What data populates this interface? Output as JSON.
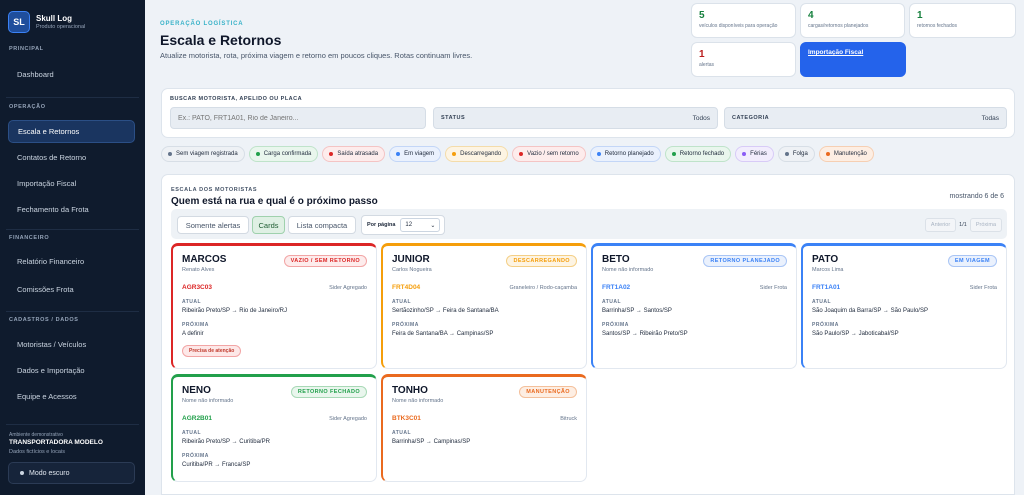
{
  "colors": {
    "sidebar_bg": "#0f1b2d",
    "primary": "#2463eb",
    "red": "#dc2626",
    "orange": "#f59e0b",
    "blue": "#3b82f6",
    "green": "#22a04b",
    "deep_orange": "#ea6a1f"
  },
  "sidebar": {
    "brand_logo": "SL",
    "brand_name": "Skull Log",
    "brand_sub": "Produto operacional",
    "sections": [
      {
        "title": "PRINCIPAL",
        "items": [
          {
            "label": "Dashboard"
          }
        ]
      },
      {
        "title": "OPERAÇÃO",
        "items": [
          {
            "label": "Escala e Retornos"
          },
          {
            "label": "Contatos de Retorno"
          },
          {
            "label": "Importação Fiscal"
          },
          {
            "label": "Fechamento da Frota"
          }
        ]
      },
      {
        "title": "FINANCEIRO",
        "items": [
          {
            "label": "Relatório Financeiro"
          },
          {
            "label": "Comissões Frota"
          }
        ]
      },
      {
        "title": "CADASTROS / DADOS",
        "items": [
          {
            "label": "Motoristas / Veículos"
          },
          {
            "label": "Dados e Importação"
          },
          {
            "label": "Equipe e Acessos"
          }
        ]
      }
    ],
    "demo_label": "Ambiente demonstrativo",
    "company": "TRANSPORTADORA MODELO",
    "demo_data": "Dados fictícios e locais",
    "dark_mode_label": "Modo escuro"
  },
  "header": {
    "eyebrow": "OPERAÇÃO LOGÍSTICA",
    "title": "Escala e Retornos",
    "subtitle": "Atualize motorista, rota, próxima viagem e retorno em poucos cliques. Rotas continuam livres."
  },
  "stats": [
    {
      "value": "5",
      "label": "veículos disponíveis para operação",
      "color": "#15803d"
    },
    {
      "value": "4",
      "label": "cargas/retornos planejados",
      "color": "#15803d"
    },
    {
      "value": "1",
      "label": "retornos fechados",
      "color": "#15803d"
    },
    {
      "value": "1",
      "label": "alertas",
      "color": "#b91c1c"
    }
  ],
  "import_button": "Importação Fiscal",
  "filters": {
    "search_label": "BUSCAR MOTORISTA, APELIDO OU PLACA",
    "search_placeholder": "Ex.: PATO, FRT1A01, Rio de Janeiro...",
    "status_label": "STATUS",
    "status_value": "Todos",
    "category_label": "CATEGORIA",
    "category_value": "Todas"
  },
  "legend": [
    {
      "label": "Sem viagem registrada",
      "dot": "#64748b",
      "bg": "#eef1f5",
      "border": "#d7dee6"
    },
    {
      "label": "Carga confirmada",
      "dot": "#22a04b",
      "bg": "#e9f6ed",
      "border": "#bfe3ca"
    },
    {
      "label": "Saída atrasada",
      "dot": "#dc2626",
      "bg": "#fdecec",
      "border": "#f4c4c4"
    },
    {
      "label": "Em viagem",
      "dot": "#3b82f6",
      "bg": "#eaf1fd",
      "border": "#c3d6f7"
    },
    {
      "label": "Descarregando",
      "dot": "#f59e0b",
      "bg": "#fdf4e3",
      "border": "#f4dcaa"
    },
    {
      "label": "Vazio / sem retorno",
      "dot": "#dc2626",
      "bg": "#fdecec",
      "border": "#f4c4c4"
    },
    {
      "label": "Retorno planejado",
      "dot": "#3b82f6",
      "bg": "#eaf1fd",
      "border": "#c3d6f7"
    },
    {
      "label": "Retorno fechado",
      "dot": "#22a04b",
      "bg": "#e9f6ed",
      "border": "#bfe3ca"
    },
    {
      "label": "Férias",
      "dot": "#8b5cf6",
      "bg": "#f2edfd",
      "border": "#d8cbf7"
    },
    {
      "label": "Folga",
      "dot": "#64748b",
      "bg": "#eef1f5",
      "border": "#d7dee6"
    },
    {
      "label": "Manutenção",
      "dot": "#ea6a1f",
      "bg": "#fdeee3",
      "border": "#f6cfb3"
    }
  ],
  "drivers_panel": {
    "eyebrow": "ESCALA DOS MOTORISTAS",
    "title": "Quem está na rua e qual é o próximo passo",
    "count": "mostrando 6 de 6",
    "view_buttons": [
      "Somente alertas",
      "Cards",
      "Lista compacta"
    ],
    "per_page_label": "Por página",
    "per_page_value": "12",
    "pager_prev": "Anterior",
    "pager_page": "1/1",
    "pager_next": "Próxima"
  },
  "cards": [
    {
      "name": "MARCOS",
      "subname": "Renato Alves",
      "status": "VAZIO / SEM RETORNO",
      "color": "#dc2626",
      "badge_bg": "#fdecec",
      "badge_border": "#f2a5a5",
      "plate": "AGR3C03",
      "vehicle": "Sider Agregado",
      "current_label": "ATUAL",
      "current": "Ribeirão Preto/SP → Rio de Janeiro/RJ",
      "next_label": "PRÓXIMA",
      "next": "A definir",
      "alert": "Precisa de atenção"
    },
    {
      "name": "JUNIOR",
      "subname": "Carlos Nogueira",
      "status": "DESCARREGANDO",
      "color": "#f59e0b",
      "badge_bg": "#fdf4e3",
      "badge_border": "#f4cf86",
      "plate": "FRT4D04",
      "vehicle": "Graneleiro / Rodo-caçamba",
      "current_label": "ATUAL",
      "current": "Sertãozinho/SP → Feira de Santana/BA",
      "next_label": "PRÓXIMA",
      "next": "Feira de Santana/BA → Campinas/SP",
      "alert": ""
    },
    {
      "name": "BETO",
      "subname": "Nome não informado",
      "status": "RETORNO PLANEJADO",
      "color": "#3b82f6",
      "badge_bg": "#eaf1fd",
      "badge_border": "#a9c5f5",
      "plate": "FRT1A02",
      "vehicle": "Sider Frota",
      "current_label": "ATUAL",
      "current": "Barrinha/SP → Santos/SP",
      "next_label": "PRÓXIMA",
      "next": "Santos/SP → Ribeirão Preto/SP",
      "alert": ""
    },
    {
      "name": "PATO",
      "subname": "Marcos Lima",
      "status": "EM VIAGEM",
      "color": "#3b82f6",
      "badge_bg": "#eaf1fd",
      "badge_border": "#a9c5f5",
      "plate": "FRT1A01",
      "vehicle": "Sider Frota",
      "current_label": "ATUAL",
      "current": "São Joaquim da Barra/SP → São Paulo/SP",
      "next_label": "PRÓXIMA",
      "next": "São Paulo/SP → Jaboticabal/SP",
      "alert": ""
    },
    {
      "name": "NENO",
      "subname": "Nome não informado",
      "status": "RETORNO FECHADO",
      "color": "#22a04b",
      "badge_bg": "#e9f6ed",
      "badge_border": "#a8d9b6",
      "plate": "AGR2B01",
      "vehicle": "Sider Agregado",
      "current_label": "ATUAL",
      "current": "Ribeirão Preto/SP → Curitiba/PR",
      "next_label": "PRÓXIMA",
      "next": "Curitiba/PR → Franca/SP",
      "alert": ""
    },
    {
      "name": "TONHO",
      "subname": "Nome não informado",
      "status": "MANUTENÇÃO",
      "color": "#ea6a1f",
      "badge_bg": "#fdeee3",
      "badge_border": "#f4c09b",
      "plate": "BTK3C01",
      "vehicle": "Bitruck",
      "current_label": "ATUAL",
      "current": "Barrinha/SP → Campinas/SP",
      "next_label": "",
      "next": "",
      "alert": ""
    }
  ]
}
